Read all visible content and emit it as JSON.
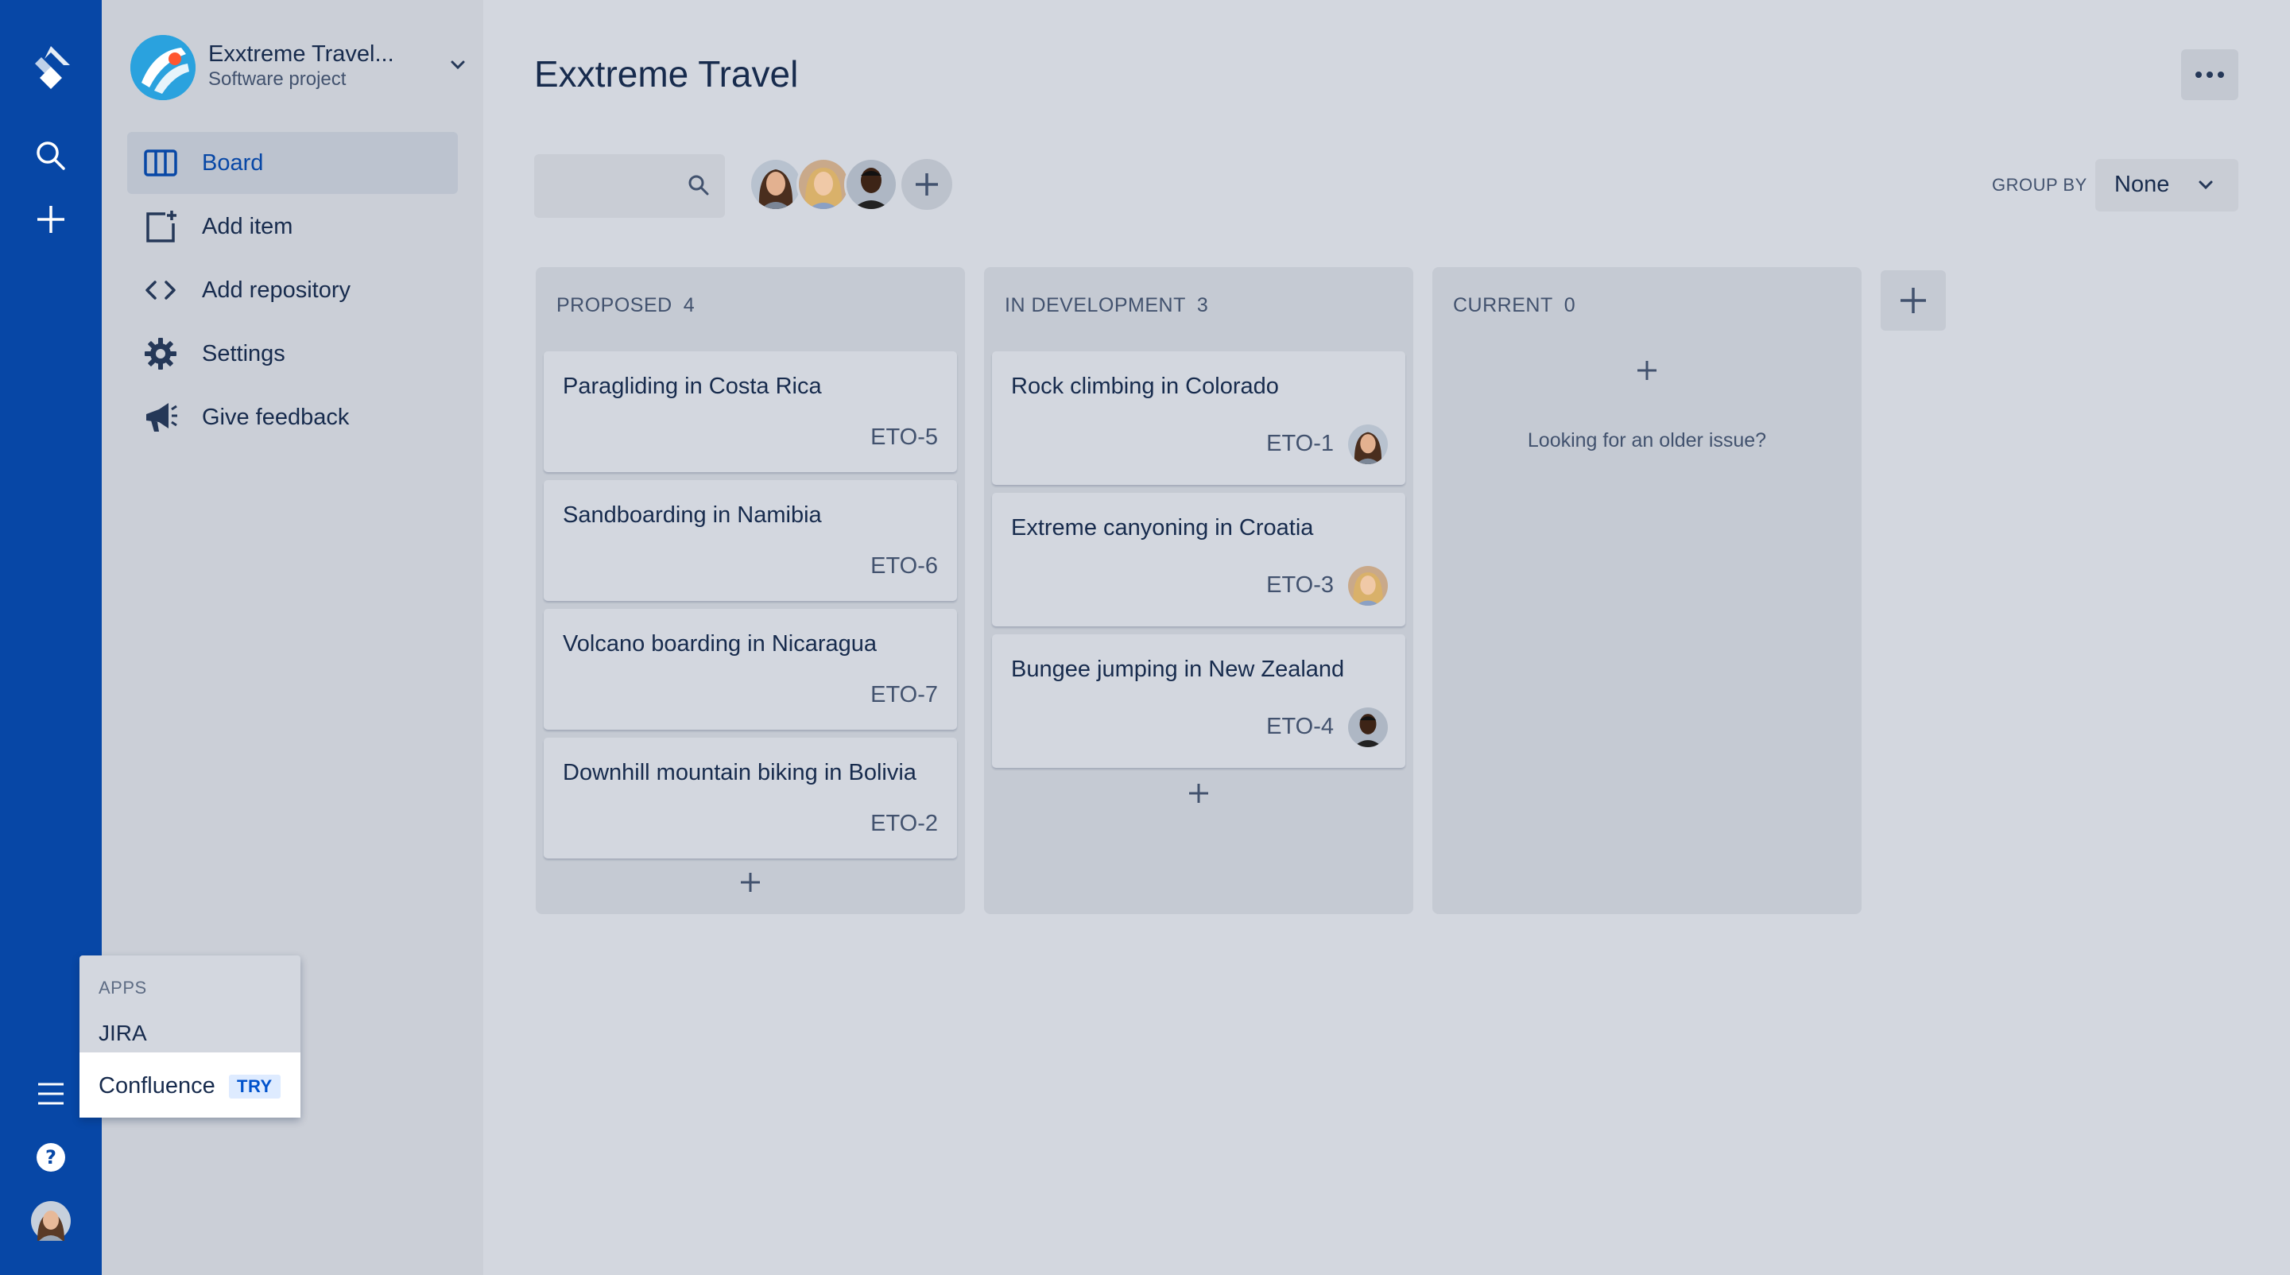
{
  "colors": {
    "rail": "#0747a6",
    "sidebar": "#cbcfd7",
    "background": "#d3d7df",
    "column": "#c5cad3",
    "active_text": "#0747a6",
    "try_badge_bg": "#deebff",
    "try_badge_text": "#0052cc"
  },
  "rail": {
    "icons": [
      "jira-logo-icon",
      "search-icon",
      "create-plus-icon",
      "menu-icon",
      "help-icon",
      "user-avatar"
    ]
  },
  "sidebar": {
    "project_name": "Exxtreme Travel...",
    "project_type": "Software project",
    "items": [
      {
        "label": "Board",
        "icon": "board-icon",
        "active": true
      },
      {
        "label": "Add item",
        "icon": "add-item-icon"
      },
      {
        "label": "Add repository",
        "icon": "code-icon"
      },
      {
        "label": "Settings",
        "icon": "gear-icon"
      },
      {
        "label": "Give feedback",
        "icon": "megaphone-icon"
      }
    ]
  },
  "header": {
    "title": "Exxtreme Travel"
  },
  "toolbar": {
    "search_placeholder": "",
    "group_by_label": "GROUP BY",
    "group_by_value": "None"
  },
  "columns": [
    {
      "name": "PROPOSED",
      "count": "4",
      "cards": [
        {
          "title": "Paragliding in Costa Rica",
          "key": "ETO-5"
        },
        {
          "title": "Sandboarding in Namibia",
          "key": "ETO-6"
        },
        {
          "title": "Volcano boarding in Nicaragua",
          "key": "ETO-7"
        },
        {
          "title": "Downhill mountain biking in Bolivia",
          "key": "ETO-2"
        }
      ]
    },
    {
      "name": "IN DEVELOPMENT",
      "count": "3",
      "cards": [
        {
          "title": "Rock climbing in Colorado",
          "key": "ETO-1",
          "assignee": "avatar-woman-dark-hair"
        },
        {
          "title": "Extreme canyoning in Croatia",
          "key": "ETO-3",
          "assignee": "avatar-woman-blonde"
        },
        {
          "title": "Bungee jumping in New Zealand",
          "key": "ETO-4",
          "assignee": "avatar-man"
        }
      ]
    },
    {
      "name": "CURRENT",
      "count": "0",
      "cards": [],
      "empty_text": "Looking for an older issue?"
    }
  ],
  "apps_menu": {
    "heading": "APPS",
    "items": [
      {
        "label": "JIRA"
      },
      {
        "label": "Confluence",
        "badge": "TRY"
      }
    ]
  }
}
